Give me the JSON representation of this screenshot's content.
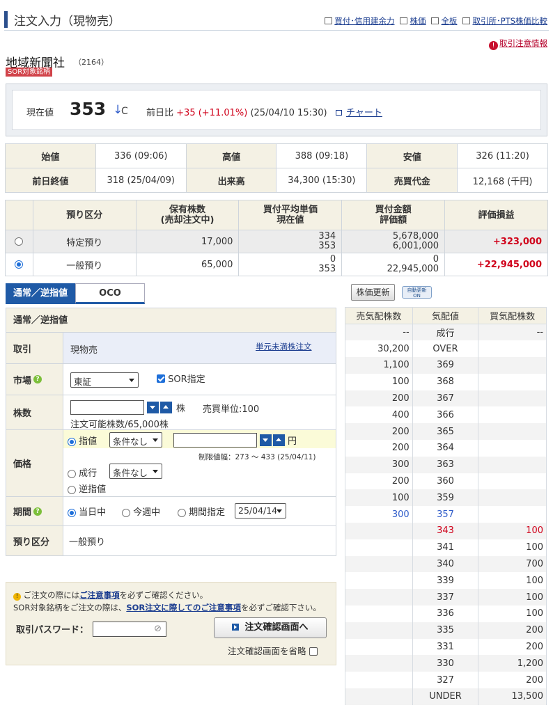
{
  "header": {
    "title": "注文入力（現物売）",
    "links": [
      {
        "icon": "calculator-icon",
        "label": "買付･信用建余力"
      },
      {
        "icon": "list-icon",
        "label": "株価"
      },
      {
        "icon": "board-icon",
        "label": "全板"
      },
      {
        "icon": "printer-icon",
        "label": "取引所･PTS株価比較"
      }
    ]
  },
  "caution_link": "取引注意情報",
  "stock": {
    "name": "地域新聞社",
    "code": "（2164）",
    "badge": "SOR対象銘柄"
  },
  "price": {
    "label": "現在値",
    "value": "353",
    "arrow": "↓",
    "flag": "C",
    "change_label": "前日比",
    "change": "+35 (+11.01%)",
    "time": "(25/04/10 15:30)",
    "chart_link": "チャート"
  },
  "stats": [
    [
      {
        "h": "始値",
        "v": "336 (09:06)"
      },
      {
        "h": "高値",
        "v": "388 (09:18)"
      },
      {
        "h": "安値",
        "v": "326 (11:20)"
      }
    ],
    [
      {
        "h": "前日終値",
        "v": "318 (25/04/09)"
      },
      {
        "h": "出来高",
        "v": "34,300 (15:30)"
      },
      {
        "h": "売買代金",
        "v": "12,168 (千円)"
      }
    ]
  ],
  "holdings": {
    "headers": [
      "預り区分",
      "保有株数\n(売却注文中)",
      "買付平均単価\n現在値",
      "買付金額\n評価額",
      "評価損益"
    ],
    "rows": [
      {
        "type": "特定預り",
        "shares": "17,000",
        "avg": "334",
        "cur": "353",
        "amt": "5,678,000",
        "val": "6,001,000",
        "pl": "+323,000",
        "selected": false
      },
      {
        "type": "一般預り",
        "shares": "65,000",
        "avg": "0",
        "cur": "353",
        "amt": "0",
        "val": "22,945,000",
        "pl": "+22,945,000",
        "selected": true
      }
    ]
  },
  "tabs": {
    "normal": "通常／逆指値",
    "oco": "OCO"
  },
  "form": {
    "title": "通常／逆指値",
    "trade_label": "取引",
    "trade_value": "現物売",
    "odd_lot_link": "単元未満株注文",
    "market_label": "市場",
    "market_value": "東証",
    "sor_label": "SOR指定",
    "qty_label": "株数",
    "qty_unit": "株",
    "trade_unit": "売買単位:100",
    "qty_avail": "注文可能株数/65,000株",
    "price_label": "価格",
    "limit_label": "指値",
    "cond1": "条件なし",
    "yen": "円",
    "range": "制限値幅：273 ～ 433 (25/04/11)",
    "market_order": "成行",
    "cond2": "条件なし",
    "stop": "逆指値",
    "period_label": "期間",
    "today": "当日中",
    "this_week": "今週中",
    "specify": "期間指定",
    "date": "25/04/14",
    "account_label": "預り区分",
    "account_value": "一般預り"
  },
  "notice": {
    "line1a": "ご注文の際には",
    "line1link": "ご注意事項",
    "line1b": "を必ずご確認ください。",
    "line2a": "SOR対象銘柄をご注文の際は、",
    "line2link": "SOR注文に際してのご注意事項",
    "line2b": "を必ずご確認下さい。",
    "pw_label": "取引パスワード：",
    "confirm_button": "注文確認画面へ",
    "skip_label": "注文確認画面を省略"
  },
  "book": {
    "refresh": "株価更新",
    "auto": "自動更新\nON",
    "headers": [
      "売気配株数",
      "気配値",
      "買気配株数"
    ],
    "rows": [
      [
        "--",
        "成行",
        "--"
      ],
      [
        "30,200",
        "OVER",
        ""
      ],
      [
        "1,100",
        "369",
        ""
      ],
      [
        "100",
        "368",
        ""
      ],
      [
        "200",
        "367",
        ""
      ],
      [
        "400",
        "366",
        ""
      ],
      [
        "200",
        "365",
        ""
      ],
      [
        "200",
        "364",
        ""
      ],
      [
        "300",
        "363",
        ""
      ],
      [
        "200",
        "360",
        ""
      ],
      [
        "100",
        "359",
        ""
      ],
      [
        "300",
        "357",
        ""
      ],
      [
        "",
        "343",
        "100"
      ],
      [
        "",
        "341",
        "100"
      ],
      [
        "",
        "340",
        "700"
      ],
      [
        "",
        "339",
        "100"
      ],
      [
        "",
        "337",
        "100"
      ],
      [
        "",
        "336",
        "100"
      ],
      [
        "",
        "335",
        "200"
      ],
      [
        "",
        "331",
        "200"
      ],
      [
        "",
        "330",
        "1,200"
      ],
      [
        "",
        "327",
        "200"
      ],
      [
        "",
        "UNDER",
        "13,500"
      ]
    ],
    "highlight_sell_row": 11,
    "highlight_buy_row": 12,
    "sell_color": "#2f5cc9",
    "buy_color": "#d0021b"
  }
}
